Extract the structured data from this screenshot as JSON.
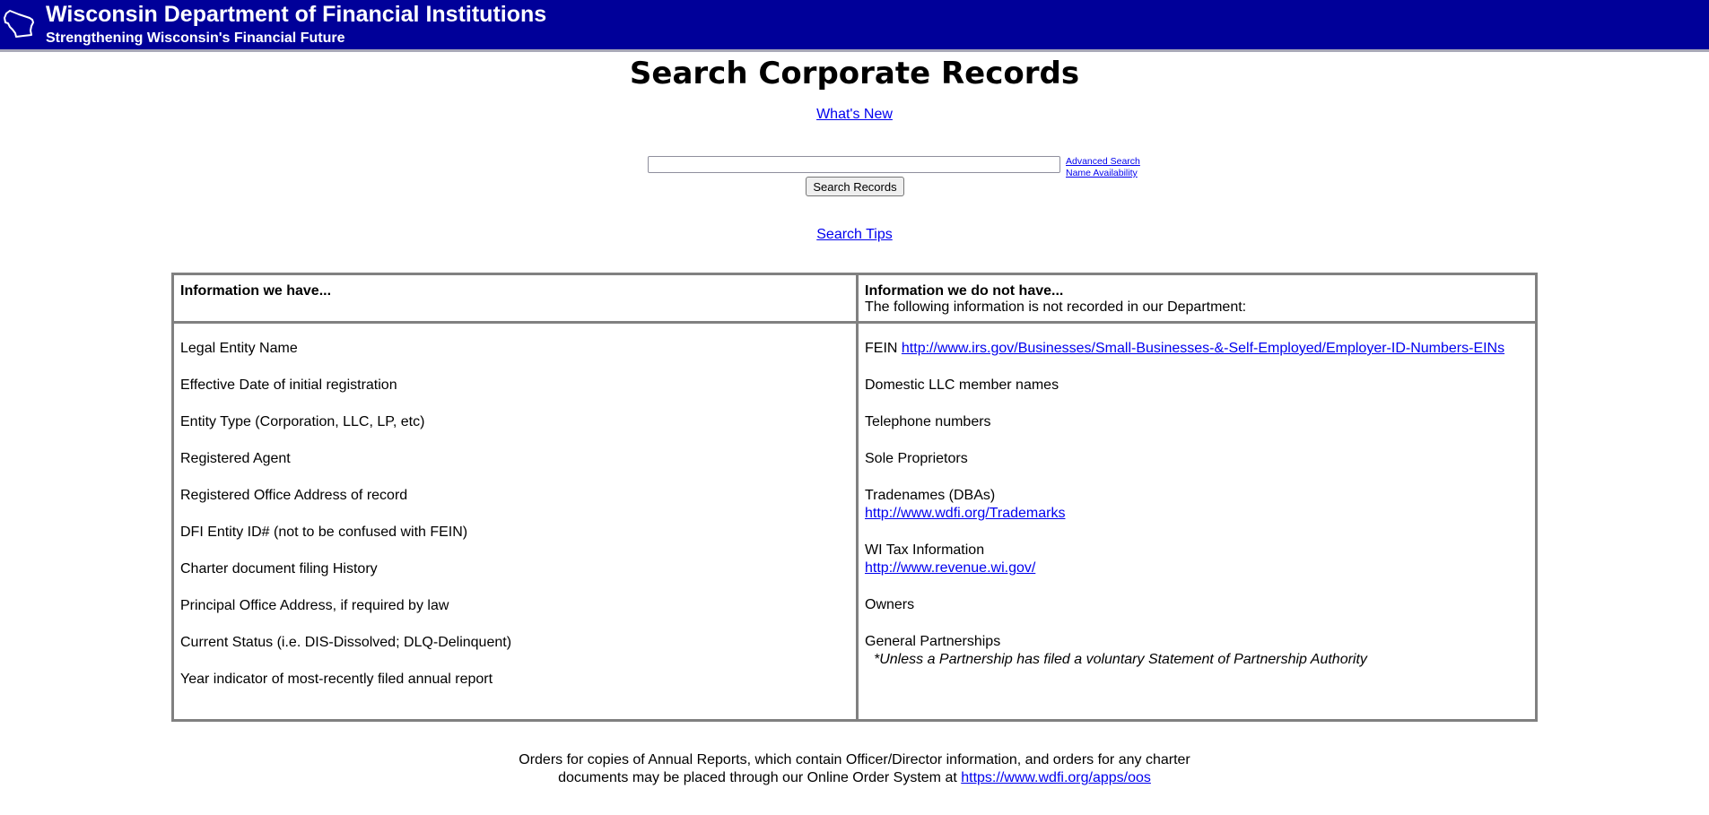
{
  "header": {
    "logo_icon": "wisconsin-state-outline-icon",
    "title": "Wisconsin Department of Financial Institutions",
    "subtitle": "Strengthening Wisconsin's Financial Future",
    "background_color": "#000099"
  },
  "page_title": "Search Corporate Records",
  "links": {
    "whats_new": "What's New",
    "advanced_search": "Advanced Search",
    "name_availability": "Name Availability",
    "search_tips": "Search Tips"
  },
  "search": {
    "input_value": "",
    "placeholder": "",
    "button_label": "Search Records"
  },
  "info_table": {
    "have_header": "Information we have...",
    "not_have_header": "Information we do not have...",
    "not_have_subheader": "The following information is not recorded in our Department:",
    "have_items": [
      "Legal Entity Name",
      "Effective Date of initial registration",
      "Entity Type (Corporation, LLC, LP, etc)",
      "Registered Agent",
      "Registered Office Address of record",
      "DFI Entity ID# (not to be confused with FEIN)",
      "Charter document filing History",
      "Principal Office Address, if required by law",
      "Current Status (i.e. DIS-Dissolved; DLQ-Delinquent)",
      "Year indicator of most-recently filed annual report"
    ],
    "not_have_items": [
      {
        "label": "FEIN",
        "link": "http://www.irs.gov/Businesses/Small-Businesses-&-Self-Employed/Employer-ID-Numbers-EINs"
      },
      {
        "label": "Domestic LLC member names"
      },
      {
        "label": "Telephone numbers"
      },
      {
        "label": "Sole Proprietors"
      },
      {
        "label": "Tradenames (DBAs)",
        "link": "http://www.wdfi.org/Trademarks"
      },
      {
        "label": "WI Tax Information",
        "link": "http://www.revenue.wi.gov/"
      },
      {
        "label": "Owners"
      },
      {
        "label": "General Partnerships",
        "note": "*Unless a Partnership has filed a voluntary Statement of Partnership Authority"
      }
    ]
  },
  "footer": {
    "line1": "Orders for copies of Annual Reports, which contain Officer/Director information, and orders for any charter",
    "line2_prefix": "documents may be placed through our Online Order System at",
    "link": "https://www.wdfi.org/apps/oos"
  }
}
